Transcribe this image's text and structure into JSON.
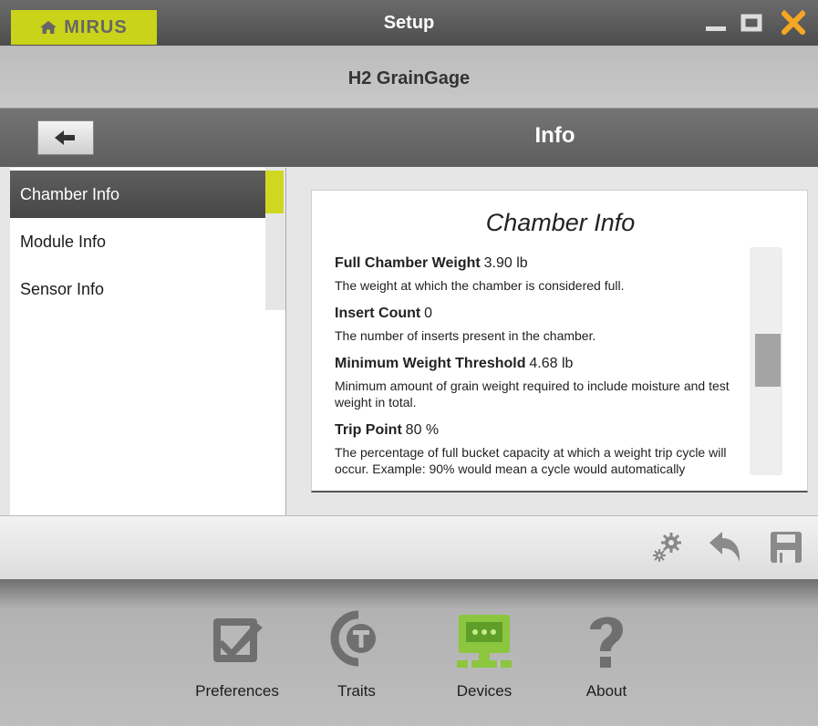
{
  "titlebar": {
    "brand": "MIRUS",
    "title": "Setup",
    "brand_color": "#c9d31a",
    "close_color": "#f5a623"
  },
  "subtitle": "H2 GrainGage",
  "nav": {
    "title": "Info"
  },
  "left_menu": [
    {
      "label": "Chamber Info",
      "selected": true
    },
    {
      "label": "Module Info",
      "selected": false
    },
    {
      "label": "Sensor Info",
      "selected": false
    }
  ],
  "info": {
    "heading": "Chamber Info",
    "fields": [
      {
        "label": "Full Chamber Weight",
        "value": "3.90 lb",
        "desc": "The weight at which the chamber is considered full."
      },
      {
        "label": "Insert Count",
        "value": "0",
        "desc": "The number of inserts present in the chamber."
      },
      {
        "label": "Minimum Weight Threshold",
        "value": "4.68 lb",
        "desc": "Minimum amount of grain weight required to include moisture and test weight in total."
      },
      {
        "label": "Trip Point",
        "value": "80 %",
        "desc": "The percentage of full bucket capacity at which a weight trip cycle will occur. Example: 90% would mean a cycle would automatically"
      }
    ]
  },
  "toolbar_icons": [
    "gear-icon",
    "undo-icon",
    "save-icon"
  ],
  "bottom_nav": [
    {
      "label": "Preferences",
      "icon": "checkbox-icon",
      "active": false
    },
    {
      "label": "Traits",
      "icon": "traits-icon",
      "active": false
    },
    {
      "label": "Devices",
      "icon": "device-icon",
      "active": true
    },
    {
      "label": "About",
      "icon": "question-icon",
      "active": false
    }
  ],
  "accent_green": "#8cc63f"
}
